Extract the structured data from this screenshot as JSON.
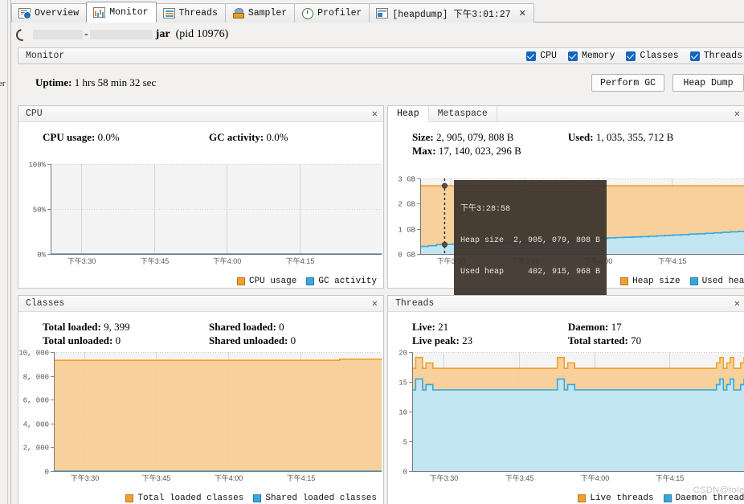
{
  "window": {
    "tabs": [
      {
        "label": "Overview",
        "icon": "overview-icon",
        "selected": false,
        "closable": false
      },
      {
        "label": "Monitor",
        "icon": "monitor-icon",
        "selected": true,
        "closable": false
      },
      {
        "label": "Threads",
        "icon": "threads-icon",
        "selected": false,
        "closable": false
      },
      {
        "label": "Sampler",
        "icon": "sampler-icon",
        "selected": false,
        "closable": false
      },
      {
        "label": "Profiler",
        "icon": "profiler-icon",
        "selected": false,
        "closable": false
      },
      {
        "label": "[heapdump] 下午3:01:27",
        "icon": "heapdump-icon",
        "selected": false,
        "closable": true,
        "close_glyph": "✕"
      }
    ],
    "sidebar_vertical_label": "er"
  },
  "process": {
    "jar_label": "jar",
    "pid_label": "(pid 10976)",
    "spinner_icon": "loading-spinner-icon"
  },
  "monitor_bar": {
    "title": "Monitor",
    "checkboxes": [
      {
        "label": "CPU",
        "checked": true
      },
      {
        "label": "Memory",
        "checked": true
      },
      {
        "label": "Classes",
        "checked": true
      },
      {
        "label": "Threads",
        "checked": true
      }
    ]
  },
  "uptime": {
    "label": "Uptime:",
    "value": "1 hrs 58 min 32 sec"
  },
  "actions": {
    "perform_gc": "Perform GC",
    "heap_dump": "Heap Dump"
  },
  "colors": {
    "orange": "#f0a030",
    "orange_fill": "#f6c98a",
    "blue": "#35a8dd",
    "blue_fill": "#bfe6f6",
    "checkbox_blue": "#1566c0",
    "plot_bg": "#f4f4f4",
    "tooltip_bg": "#3b322b"
  },
  "panels": {
    "cpu": {
      "title": "CPU",
      "close_glyph": "✕",
      "stats": [
        {
          "label": "CPU usage:",
          "value": "0.0%"
        },
        {
          "label": "GC activity:",
          "value": "0.0%"
        }
      ],
      "legend": [
        {
          "label": "CPU usage",
          "color": "#f0a030"
        },
        {
          "label": "GC activity",
          "color": "#35a8dd"
        }
      ]
    },
    "heap": {
      "tabs": [
        {
          "label": "Heap",
          "active": true
        },
        {
          "label": "Metaspace",
          "active": false
        }
      ],
      "close_glyph": "✕",
      "stats": [
        {
          "label": "Size:",
          "value": "2, 905, 079, 808 B"
        },
        {
          "label": "Used:",
          "value": "1, 035, 355, 712 B"
        },
        {
          "label": "Max:",
          "value": "17, 140, 023, 296 B"
        }
      ],
      "tooltip": {
        "time": "下午3:28:58",
        "rows": [
          {
            "label": "Heap size",
            "value": "2, 905, 079, 808 B"
          },
          {
            "label": "Used heap",
            "value": "402, 915, 968 B"
          }
        ]
      },
      "legend": [
        {
          "label": "Heap size",
          "color": "#f0a030"
        },
        {
          "label": "Used heap",
          "color": "#35a8dd"
        }
      ]
    },
    "classes": {
      "title": "Classes",
      "close_glyph": "✕",
      "stats": [
        {
          "label": "Total loaded:",
          "value": "9, 399"
        },
        {
          "label": "Shared loaded:",
          "value": "0"
        },
        {
          "label": "Total unloaded:",
          "value": "0"
        },
        {
          "label": "Shared unloaded:",
          "value": "0"
        }
      ],
      "legend": [
        {
          "label": "Total loaded classes",
          "color": "#f0a030"
        },
        {
          "label": "Shared loaded classes",
          "color": "#35a8dd"
        }
      ]
    },
    "threads": {
      "title": "Threads",
      "close_glyph": "✕",
      "stats": [
        {
          "label": "Live:",
          "value": "21"
        },
        {
          "label": "Daemon:",
          "value": "17"
        },
        {
          "label": "Live peak:",
          "value": "23"
        },
        {
          "label": "Total started:",
          "value": "70"
        }
      ],
      "legend": [
        {
          "label": "Live threads",
          "color": "#f0a030"
        },
        {
          "label": "Daemon threads",
          "color": "#35a8dd"
        }
      ]
    }
  },
  "watermark": "CSDN@tolee",
  "chart_data": [
    {
      "id": "cpu",
      "type": "area",
      "title": "CPU",
      "xlabel": "",
      "ylabel": "",
      "x_ticks": [
        "下午3:30",
        "下午3:45",
        "下午4:00",
        "下午4:15"
      ],
      "y_ticks": [
        "0%",
        "50%",
        "100%"
      ],
      "ylim": [
        0,
        100
      ],
      "grid": true,
      "legend_position": "bottom-right",
      "series": [
        {
          "name": "CPU usage",
          "color": "#f0a030",
          "values": [
            0,
            0,
            0,
            0,
            0,
            0,
            0,
            0,
            0,
            0,
            0,
            0,
            0,
            0,
            0,
            0,
            0,
            0,
            0,
            0,
            0,
            0,
            0,
            0,
            0,
            0,
            0,
            0,
            0,
            0,
            0,
            0,
            0,
            0,
            0,
            0,
            0,
            0,
            0,
            0
          ]
        },
        {
          "name": "GC activity",
          "color": "#35a8dd",
          "values": [
            0,
            0,
            0,
            0,
            0,
            0,
            0,
            0,
            0,
            0,
            0,
            0,
            0,
            0,
            0,
            0,
            0,
            0,
            0,
            0,
            0,
            0,
            0,
            0,
            0,
            0,
            0,
            0,
            0,
            0,
            0,
            0,
            0,
            0,
            0,
            0,
            0,
            0,
            0,
            0
          ]
        }
      ]
    },
    {
      "id": "heap",
      "type": "area",
      "title": "Heap",
      "xlabel": "",
      "ylabel": "",
      "x_ticks": [
        "下午3:30",
        "下午3:45",
        "下午4:00",
        "下午4:15"
      ],
      "y_ticks": [
        "0 GB",
        "1 GB",
        "2 GB",
        "3 GB"
      ],
      "ylim": [
        0,
        3
      ],
      "grid": true,
      "legend_position": "bottom-right",
      "unit": "GB",
      "series": [
        {
          "name": "Heap size",
          "color": "#f0a030",
          "values": [
            2.71,
            2.71,
            2.71,
            2.71,
            2.71,
            2.71,
            2.71,
            2.71,
            2.71,
            2.71,
            2.71,
            2.71,
            2.71,
            2.71,
            2.71,
            2.71,
            2.71,
            2.71,
            2.71,
            2.71,
            2.71,
            2.71,
            2.71,
            2.71,
            2.71,
            2.71,
            2.71,
            2.71,
            2.71,
            2.71,
            2.71,
            2.71,
            2.71,
            2.71,
            2.71,
            2.71,
            2.71,
            2.71,
            2.71,
            2.71
          ]
        },
        {
          "name": "Used heap",
          "color": "#35a8dd",
          "values": [
            0.3,
            0.33,
            0.375,
            0.385,
            0.395,
            0.4,
            0.41,
            0.415,
            0.42,
            0.43,
            0.44,
            0.45,
            0.455,
            0.46,
            0.47,
            0.48,
            0.5,
            0.51,
            0.52,
            0.55,
            0.57,
            0.6,
            0.62,
            0.64,
            0.655,
            0.665,
            0.675,
            0.69,
            0.705,
            0.72,
            0.74,
            0.755,
            0.77,
            0.79,
            0.8,
            0.82,
            0.84,
            0.86,
            0.88,
            0.9,
            0.93,
            0.96
          ]
        }
      ],
      "marker": {
        "x_index": 3,
        "series_values": [
          2.71,
          0.375
        ]
      }
    },
    {
      "id": "classes",
      "type": "area",
      "title": "Classes",
      "xlabel": "",
      "ylabel": "",
      "x_ticks": [
        "下午3:30",
        "下午3:45",
        "下午4:00",
        "下午4:15"
      ],
      "y_ticks": [
        "0",
        "2, 000",
        "4, 000",
        "6, 000",
        "8, 000",
        "10, 000"
      ],
      "ylim": [
        0,
        10000
      ],
      "grid": true,
      "legend_position": "bottom-right",
      "series": [
        {
          "name": "Total loaded classes",
          "color": "#f0a030",
          "values": [
            9310,
            9310,
            9310,
            9310,
            9310,
            9310,
            9310,
            9310,
            9310,
            9310,
            9310,
            9310,
            9310,
            9310,
            9310,
            9310,
            9310,
            9310,
            9310,
            9310,
            9310,
            9310,
            9310,
            9310,
            9310,
            9310,
            9310,
            9310,
            9310,
            9310,
            9310,
            9310,
            9310,
            9310,
            9399,
            9399,
            9399,
            9399,
            9399,
            9399
          ]
        },
        {
          "name": "Shared loaded classes",
          "color": "#35a8dd",
          "values": [
            0,
            0,
            0,
            0,
            0,
            0,
            0,
            0,
            0,
            0,
            0,
            0,
            0,
            0,
            0,
            0,
            0,
            0,
            0,
            0,
            0,
            0,
            0,
            0,
            0,
            0,
            0,
            0,
            0,
            0,
            0,
            0,
            0,
            0,
            0,
            0,
            0,
            0,
            0,
            0
          ]
        }
      ]
    },
    {
      "id": "threads",
      "type": "area",
      "title": "Threads",
      "xlabel": "",
      "ylabel": "",
      "x_ticks": [
        "下午3:30",
        "下午3:45",
        "下午4:00",
        "下午4:15"
      ],
      "y_ticks": [
        "0",
        "5",
        "10",
        "15",
        "20"
      ],
      "ylim": [
        0,
        22
      ],
      "grid": true,
      "legend_position": "bottom-right",
      "series": [
        {
          "name": "Live threads",
          "color": "#f0a030",
          "values": [
            19,
            21,
            21,
            19,
            20,
            20,
            19,
            19,
            19,
            19,
            19,
            19,
            19,
            19,
            19,
            19,
            19,
            19,
            19,
            19,
            19,
            19,
            19,
            19,
            19,
            19,
            19,
            19,
            19,
            19,
            19,
            19,
            19,
            19,
            19,
            19,
            19,
            19,
            19,
            19,
            19,
            19,
            21,
            21,
            19,
            20,
            20,
            19,
            19,
            19,
            19,
            19,
            19,
            19,
            19,
            19,
            19,
            19,
            19,
            19,
            19,
            19,
            19,
            19,
            19,
            19,
            19,
            19,
            19,
            19,
            19,
            19,
            19,
            19,
            19,
            19,
            19,
            19,
            19,
            19,
            19,
            19,
            19,
            19,
            19,
            19,
            19,
            19,
            20,
            21,
            19,
            20,
            21,
            19,
            19,
            20,
            21,
            20,
            19,
            21
          ]
        },
        {
          "name": "Daemon threads",
          "color": "#35a8dd",
          "values": [
            15,
            17,
            17,
            15,
            16,
            16,
            15,
            15,
            15,
            15,
            15,
            15,
            15,
            15,
            15,
            15,
            15,
            15,
            15,
            15,
            15,
            15,
            15,
            15,
            15,
            15,
            15,
            15,
            15,
            15,
            15,
            15,
            15,
            15,
            15,
            15,
            15,
            15,
            15,
            15,
            15,
            15,
            17,
            17,
            15,
            16,
            16,
            15,
            15,
            15,
            15,
            15,
            15,
            15,
            15,
            15,
            15,
            15,
            15,
            15,
            15,
            15,
            15,
            15,
            15,
            15,
            15,
            15,
            15,
            15,
            15,
            15,
            15,
            15,
            15,
            15,
            15,
            15,
            15,
            15,
            15,
            15,
            15,
            15,
            15,
            15,
            15,
            15,
            16,
            17,
            15,
            16,
            17,
            15,
            15,
            16,
            17,
            16,
            15,
            17
          ]
        }
      ]
    }
  ]
}
